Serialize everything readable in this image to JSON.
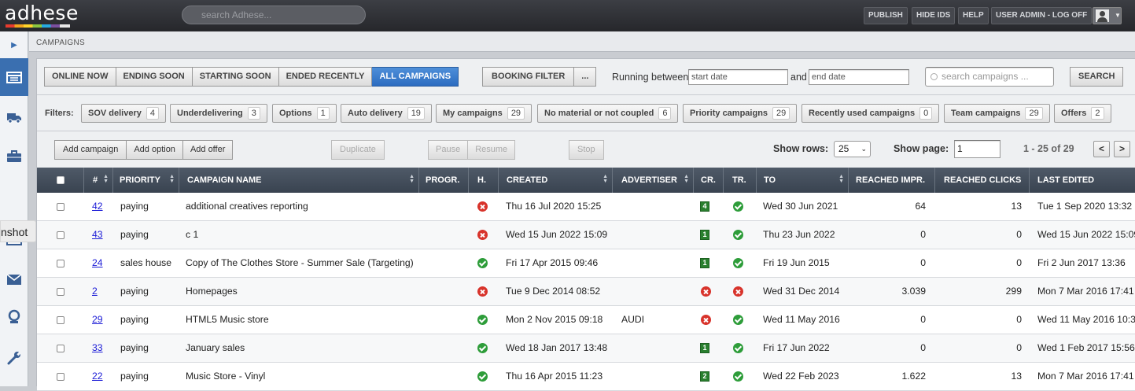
{
  "app": {
    "logo_text": "adhese",
    "search_placeholder": "search Adhese..."
  },
  "topnav": {
    "publish": "PUBLISH",
    "hide_ids": "HIDE IDS",
    "help": "HELP",
    "user": "USER ADMIN - LOG OFF"
  },
  "sidebar": {
    "tooltip": "nshot",
    "icons": [
      "campaigns-icon",
      "truck-icon",
      "briefcase-icon",
      "calendar-icon",
      "mail-icon",
      "user-icon",
      "wrench-icon"
    ]
  },
  "breadcrumb": "CAMPAIGNS",
  "status_tabs": [
    "ONLINE NOW",
    "ENDING SOON",
    "STARTING SOON",
    "ENDED RECENTLY",
    "ALL CAMPAIGNS"
  ],
  "booking_filter": {
    "label": "BOOKING FILTER",
    "more": "..."
  },
  "date_range": {
    "label_between": "Running between",
    "start_placeholder": "start date",
    "label_and": "and",
    "end_placeholder": "end date"
  },
  "campaign_search": {
    "placeholder": "search campaigns ...",
    "button": "SEARCH"
  },
  "filters": {
    "label": "Filters:",
    "items": [
      {
        "label": "SOV delivery",
        "count": "4"
      },
      {
        "label": "Underdelivering",
        "count": "3"
      },
      {
        "label": "Options",
        "count": "1"
      },
      {
        "label": "Auto delivery",
        "count": "19"
      },
      {
        "label": "My campaigns",
        "count": "29"
      },
      {
        "label": "No material or not coupled",
        "count": "6"
      },
      {
        "label": "Priority campaigns",
        "count": "29"
      },
      {
        "label": "Recently used campaigns",
        "count": "0"
      },
      {
        "label": "Team campaigns",
        "count": "29"
      },
      {
        "label": "Offers",
        "count": "2"
      }
    ]
  },
  "actions": {
    "add_campaign": "Add campaign",
    "add_option": "Add option",
    "add_offer": "Add offer",
    "duplicate": "Duplicate",
    "pause": "Pause",
    "resume": "Resume",
    "stop": "Stop"
  },
  "pagination": {
    "show_rows_label": "Show rows:",
    "rows_value": "25",
    "show_page_label": "Show page:",
    "page_value": "1",
    "range_text": "1 - 25 of 29",
    "prev": "<",
    "next": ">"
  },
  "table": {
    "columns": [
      "#",
      "PRIORITY",
      "CAMPAIGN NAME",
      "PROGR.",
      "H.",
      "CREATED",
      "ADVERTISER",
      "CR.",
      "TR.",
      "TO",
      "REACHED IMPR.",
      "REACHED CLICKS",
      "LAST EDITED"
    ],
    "rows": [
      {
        "id": "42",
        "priority": "paying",
        "name": "additional creatives reporting",
        "health": "bad",
        "created": "Thu 16 Jul 2020 15:25",
        "advertiser": "",
        "cr": "4",
        "tr": "ok",
        "to": "Wed 30 Jun 2021",
        "impr": "64",
        "clicks": "13",
        "edited": "Tue 1 Sep 2020 13:32"
      },
      {
        "id": "43",
        "priority": "paying",
        "name": "c 1",
        "health": "bad",
        "created": "Wed 15 Jun 2022 15:09",
        "advertiser": "",
        "cr": "1",
        "tr": "ok",
        "to": "Thu 23 Jun 2022",
        "impr": "0",
        "clicks": "0",
        "edited": "Wed 15 Jun 2022 15:09"
      },
      {
        "id": "24",
        "priority": "sales house",
        "name": "Copy of The Clothes Store - Summer Sale (Targeting)",
        "health": "ok",
        "created": "Fri 17 Apr 2015 09:46",
        "advertiser": "",
        "cr": "1",
        "tr": "ok",
        "to": "Fri 19 Jun 2015",
        "impr": "0",
        "clicks": "0",
        "edited": "Fri 2 Jun 2017 13:36"
      },
      {
        "id": "2",
        "priority": "paying",
        "name": "Homepages",
        "health": "bad",
        "created": "Tue 9 Dec 2014 08:52",
        "advertiser": "",
        "cr": "bad",
        "tr": "bad",
        "to": "Wed 31 Dec 2014",
        "impr": "3.039",
        "clicks": "299",
        "edited": "Mon 7 Mar 2016 17:41"
      },
      {
        "id": "29",
        "priority": "paying",
        "name": "HTML5 Music store",
        "health": "ok",
        "created": "Mon 2 Nov 2015 09:18",
        "advertiser": "AUDI",
        "cr": "bad",
        "tr": "ok",
        "to": "Wed 11 May 2016",
        "impr": "0",
        "clicks": "0",
        "edited": "Wed 11 May 2016 10:3"
      },
      {
        "id": "33",
        "priority": "paying",
        "name": "January sales",
        "health": "ok",
        "created": "Wed 18 Jan 2017 13:48",
        "advertiser": "",
        "cr": "1",
        "tr": "ok",
        "to": "Fri 17 Jun 2022",
        "impr": "0",
        "clicks": "0",
        "edited": "Wed 1 Feb 2017 15:56"
      },
      {
        "id": "22",
        "priority": "paying",
        "name": "Music Store - Vinyl",
        "health": "ok",
        "created": "Thu 16 Apr 2015 11:23",
        "advertiser": "",
        "cr": "2",
        "tr": "ok",
        "to": "Wed 22 Feb 2023",
        "impr": "1.622",
        "clicks": "13",
        "edited": "Mon 7 Mar 2016 17:41"
      }
    ]
  }
}
